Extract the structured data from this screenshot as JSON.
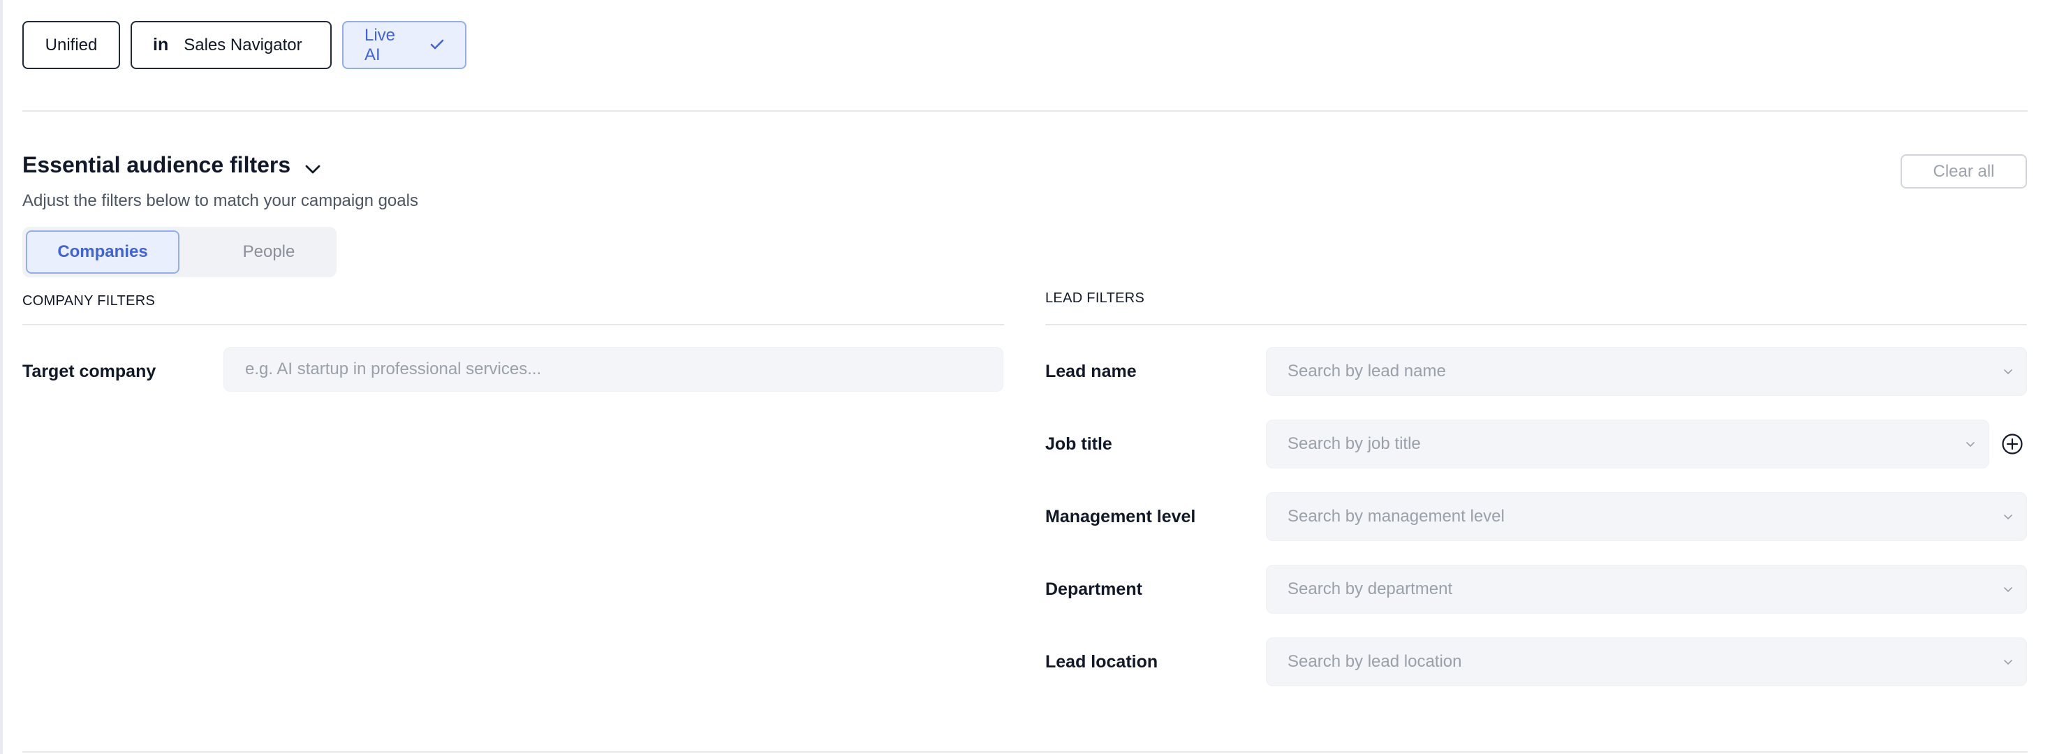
{
  "source_tabs": {
    "unified": "Unified",
    "sales_navigator": "Sales Navigator",
    "sales_navigator_icon_text": "in",
    "live_ai": "Live AI"
  },
  "section": {
    "title": "Essential audience filters",
    "subtitle": "Adjust the filters below to match your campaign goals",
    "clear_all": "Clear all"
  },
  "segment": {
    "companies": "Companies",
    "people": "People",
    "selected": "Companies"
  },
  "company_filters": {
    "heading": "COMPANY FILTERS",
    "target_company": {
      "label": "Target company",
      "placeholder": "e.g. AI startup in professional services..."
    }
  },
  "lead_filters": {
    "heading": "LEAD FILTERS",
    "rows": [
      {
        "label": "Lead name",
        "placeholder": "Search by lead name"
      },
      {
        "label": "Job title",
        "placeholder": "Search by job title"
      },
      {
        "label": "Management level",
        "placeholder": "Search by management level"
      },
      {
        "label": "Department",
        "placeholder": "Search by department"
      },
      {
        "label": "Lead location",
        "placeholder": "Search by lead location"
      }
    ]
  },
  "colors": {
    "accent": "#3f63d9",
    "accent_bg": "#e9effc",
    "accent_border": "#93acec",
    "input_bg": "#f4f5f8"
  }
}
